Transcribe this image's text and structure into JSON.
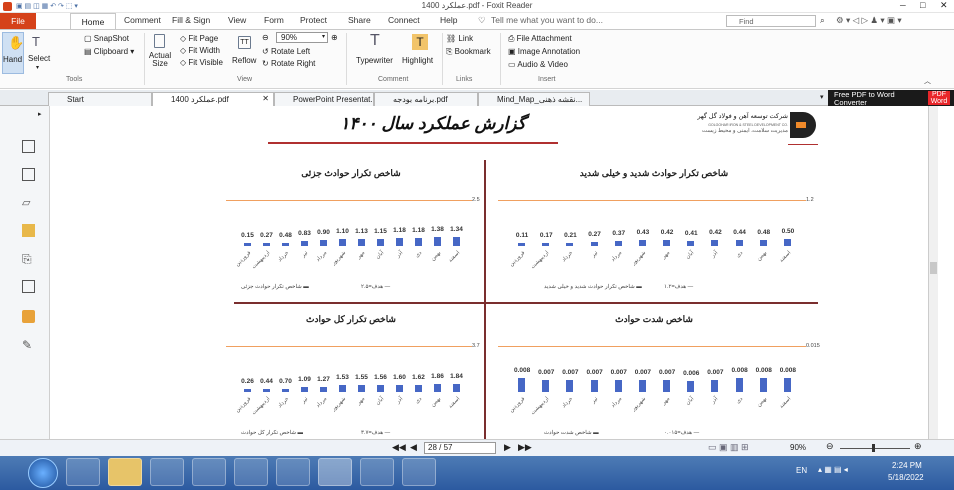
{
  "window": {
    "title": "1400 عملکرد.pdf - Foxit Reader"
  },
  "ribbon_tabs": [
    "File",
    "Home",
    "Comment",
    "Fill & Sign",
    "View",
    "Form",
    "Protect",
    "Share",
    "Connect",
    "Help"
  ],
  "tell_me": "Tell me what you want to do...",
  "find_placeholder": "Find",
  "tools": {
    "hand": "Hand",
    "select": "Select",
    "snapshot": "SnapShot",
    "clipboard": "Clipboard",
    "group": "Tools"
  },
  "view": {
    "actual_size": "Actual Size",
    "fit_page": "Fit Page",
    "fit_width": "Fit Width",
    "fit_visible": "Fit Visible",
    "reflow": "Reflow",
    "zoom": "90%",
    "rotate_left": "Rotate Left",
    "rotate_right": "Rotate Right",
    "group": "View"
  },
  "comment": {
    "typewriter": "Typewriter",
    "highlight": "Highlight",
    "group": "Comment"
  },
  "links": {
    "link": "Link",
    "bookmark": "Bookmark",
    "group": "Links"
  },
  "insert": {
    "file_attachment": "File Attachment",
    "image_annotation": "Image Annotation",
    "audio_video": "Audio & Video",
    "group": "Insert"
  },
  "doc_tabs": [
    "Start",
    "1400 عملکرد.pdf",
    "PowerPoint Presentat...",
    "برنامه بودجه.pdf",
    "Mind_Map_نقشه ذهنی..."
  ],
  "ad": {
    "line1": "Free PDF to Word",
    "line2": "Converter",
    "badge1": "PDF",
    "badge2": "Word"
  },
  "page": {
    "title": "گزارش عملکرد سال ۱۴۰۰",
    "company": "شرکت توسعه آهن و فولاد گل گهر",
    "company_en": "GOLGOHAR IRON & STEEL DEVELOPMENT CO.",
    "dept": "مدیریت سلامت، ایمنی و محیط زیست"
  },
  "months": [
    "فروردین",
    "اردیبهشت",
    "خرداد",
    "تیر",
    "مرداد",
    "شهریور",
    "مهر",
    "آبان",
    "آذر",
    "دی",
    "بهمن",
    "اسفند"
  ],
  "charts": [
    {
      "title": "شاخص تکرار حوادث شدید و خیلی شدید",
      "target": "1.2",
      "values": [
        "0.11",
        "0.17",
        "0.21",
        "0.27",
        "0.37",
        "0.43",
        "0.42",
        "0.41",
        "0.42",
        "0.44",
        "0.48",
        "0.50"
      ],
      "nums": [
        0.11,
        0.17,
        0.21,
        0.27,
        0.37,
        0.43,
        0.42,
        0.41,
        0.42,
        0.44,
        0.48,
        0.5
      ],
      "max": 1.2,
      "legend_series": "شاخص تکرار حوادث شدید و خیلی شدید",
      "legend_target": "هدف=۱.۲"
    },
    {
      "title": "شاخص تکرار حوادث جزئی",
      "target": "2.5",
      "values": [
        "0.15",
        "0.27",
        "0.48",
        "0.83",
        "0.90",
        "1.10",
        "1.13",
        "1.15",
        "1.18",
        "1.18",
        "1.38",
        "1.34"
      ],
      "nums": [
        0.15,
        0.27,
        0.48,
        0.83,
        0.9,
        1.1,
        1.13,
        1.15,
        1.18,
        1.18,
        1.38,
        1.34
      ],
      "max": 2.5,
      "legend_series": "شاخص تکرار حوادث جزئی",
      "legend_target": "هدف=۲.۵"
    },
    {
      "title": "شاخص شدت حوادث",
      "target": "0.015",
      "values": [
        "0.008",
        "0.007",
        "0.007",
        "0.007",
        "0.007",
        "0.007",
        "0.007",
        "0.006",
        "0.007",
        "0.008",
        "0.008",
        "0.008"
      ],
      "nums": [
        0.008,
        0.007,
        0.007,
        0.007,
        0.007,
        0.007,
        0.007,
        0.006,
        0.007,
        0.008,
        0.008,
        0.008
      ],
      "max": 0.009,
      "legend_series": "شاخص شدت حوادث",
      "legend_target": "هدف=۰.۰۱۵"
    },
    {
      "title": "شاخص تکرار کل حوادث",
      "target": "3.7",
      "values": [
        "0.26",
        "0.44",
        "0.70",
        "1.09",
        "1.27",
        "1.53",
        "1.55",
        "1.56",
        "1.60",
        "1.62",
        "1.86",
        "1.84"
      ],
      "nums": [
        0.26,
        0.44,
        0.7,
        1.09,
        1.27,
        1.53,
        1.55,
        1.56,
        1.6,
        1.62,
        1.86,
        1.84
      ],
      "max": 3.7,
      "legend_series": "شاخص تکرار کل حوادث",
      "legend_target": "هدف=۳.۷"
    }
  ],
  "status": {
    "page": "28 / 57",
    "zoom": "90%"
  },
  "taskbar": {
    "lang": "EN",
    "time": "2:24 PM",
    "date": "5/18/2022"
  }
}
